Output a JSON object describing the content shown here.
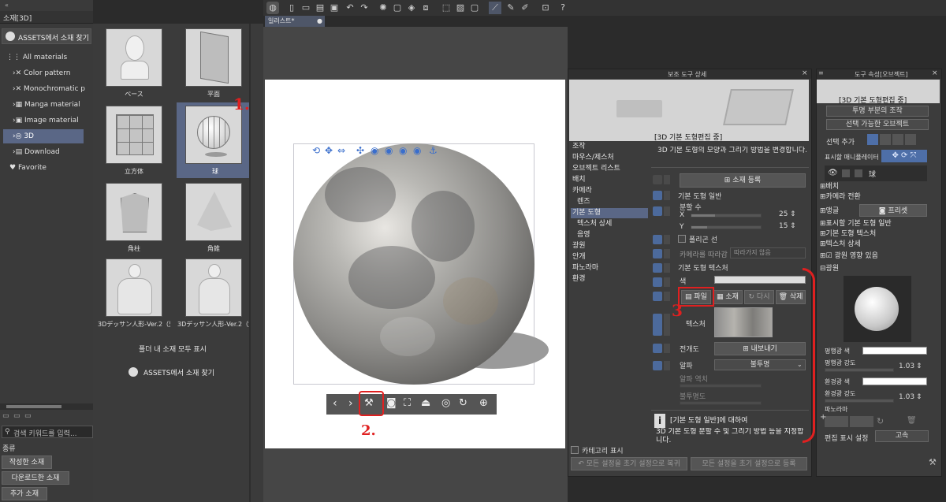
{
  "left_panel": {
    "title": "소재[3D]",
    "assets_button": "ASSETS에서 소재 찾기",
    "tree": [
      {
        "label": "All materials"
      },
      {
        "label": "Color pattern"
      },
      {
        "label": "Monochromatic p"
      },
      {
        "label": "Manga material"
      },
      {
        "label": "Image material"
      },
      {
        "label": "3D"
      },
      {
        "label": "Download"
      },
      {
        "label": "Favorite"
      }
    ],
    "search_placeholder": "검색 키워드를 입력...",
    "category_label": "종류",
    "category_buttons": [
      "작성한 소재",
      "다운로드한 소재",
      "추가 소재"
    ]
  },
  "materials": {
    "items": [
      {
        "label": "ベース"
      },
      {
        "label": "平面"
      },
      {
        "label": "立方体"
      },
      {
        "label": "球"
      },
      {
        "label": "角柱"
      },
      {
        "label": "角錐"
      },
      {
        "label": "3Dデッサン人形-Ver.2（男性"
      },
      {
        "label": "3Dデッサン人形-Ver.2（女性"
      }
    ],
    "show_all": "폴더 내 소재 모두 표시",
    "assets_button": "ASSETS에서 소재 찾기"
  },
  "canvas": {
    "tab_label": "일러스트*"
  },
  "annotations": {
    "one": "1.",
    "two": "2.",
    "three": "3"
  },
  "subtool_detail": {
    "title": "보조 도구 상세",
    "preview_label": "[3D 기본 도형편집 중]",
    "menu": [
      "조작",
      "마우스/제스처",
      "오브젝트 리스트",
      "배치",
      "카메라",
      "렌즈",
      "기본 도형",
      "텍스처 상세",
      "음영",
      "광원",
      "안개",
      "파노라마",
      "환경"
    ],
    "description": "3D 기본 도형의 모양과 그리기 방법을 변경합니다.",
    "register_button": "소재 등록",
    "section_general": "기본 도형 일반",
    "divisions": "분할 수",
    "x_label": "X",
    "x_value": "25",
    "y_label": "Y",
    "y_value": "15",
    "polygon_line": "폴리곤 선",
    "follow_camera": "카메라를 따라감",
    "follow_value": "따라가지 않음",
    "section_texture": "기본 도형 텍스처",
    "color_label": "색",
    "file_button": "파일",
    "material_button": "소재",
    "reload_button": "다시",
    "delete_button": "삭제",
    "texture_label": "텍스처",
    "unwrap_label": "전개도",
    "export_button": "내보내기",
    "alpha_label": "알파",
    "alpha_value": "불투명",
    "alpha_threshold": "알파 역치",
    "opacity": "불투명도",
    "info_title": "[기본 도형 일반]에 대하여",
    "info_text": "3D 기본 도형 분할 수 및 그리기 방법 등을 지정합니다.",
    "category_show": "카테고리 표시",
    "reset_btn": "모든 설정을 초기 설정으로 복귀",
    "register_all_btn": "모든 설정을 초기 설정으로 등록"
  },
  "tool_property": {
    "title": "도구 속성[오브젝트]",
    "editing_label": "[3D 기본 도형편집 중]",
    "transparent_ops": "투명 부분의 조작",
    "selectable": "선택 가능한 오브젝트",
    "select_add": "선택 추가",
    "manipulator": "표시할 매니퓰레이터",
    "layer_item": "球",
    "sections": [
      "배치",
      "카메라 전환",
      "앵글",
      "표시할 기본 도형 일반",
      "기본 도형 텍스처",
      "텍스처 상세",
      "광원 영향 있음",
      "광원"
    ],
    "preset_button": "프리셋",
    "parallel_color": "평행광 색",
    "parallel_strength": "평행광 강도",
    "parallel_value": "1.03",
    "ambient_color": "환경광 색",
    "ambient_strength": "환경광 강도",
    "ambient_value": "1.03",
    "panorama": "파노라마",
    "edit_display": "편집 표시 설정",
    "edit_value": "고속"
  },
  "colors": {
    "accent": "#5a6786",
    "annotation": "#e02020"
  }
}
